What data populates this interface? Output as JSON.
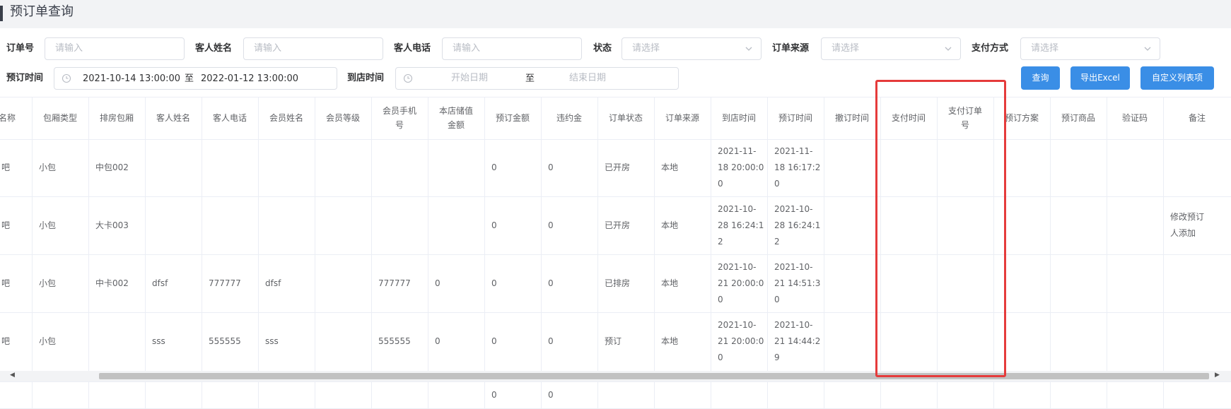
{
  "page_title": "预订单查询",
  "filters": {
    "order_no": {
      "label": "订单号",
      "placeholder": "请输入"
    },
    "guest_name": {
      "label": "客人姓名",
      "placeholder": "请输入"
    },
    "guest_phone": {
      "label": "客人电话",
      "placeholder": "请输入"
    },
    "status": {
      "label": "状态",
      "placeholder": "请选择"
    },
    "order_source": {
      "label": "订单来源",
      "placeholder": "请选择"
    },
    "payment_method": {
      "label": "支付方式",
      "placeholder": "请选择"
    },
    "booking_time": {
      "label": "预订时间",
      "start": "2021-10-14 13:00:00",
      "sep": "至",
      "end": "2022-01-12 13:00:00"
    },
    "arrival_time": {
      "label": "到店时间",
      "start_placeholder": "开始日期",
      "sep": "至",
      "end_placeholder": "结束日期"
    }
  },
  "buttons": {
    "query": "查询",
    "export": "导出Excel",
    "custom_columns": "自定义列表项"
  },
  "table": {
    "headers": [
      "名称",
      "包厢类型",
      "排房包厢",
      "客人姓名",
      "客人电话",
      "会员姓名",
      "会员等级",
      "会员手机号",
      "本店储值金额",
      "预订金额",
      "违约金",
      "订单状态",
      "订单来源",
      "到店时间",
      "预订时间",
      "撤订时间",
      "支付时间",
      "支付订单号",
      "预订方案",
      "预订商品",
      "验证码",
      "备注"
    ],
    "header_lines": {
      "7": [
        "会员手机",
        "号"
      ],
      "8": [
        "本店储值",
        "金额"
      ],
      "17": [
        "支付订单",
        "号"
      ]
    },
    "rows": [
      {
        "name": "酒吧",
        "room_type": "小包",
        "room": "中包002",
        "guest_name": "",
        "guest_phone": "",
        "member_name": "",
        "member_level": "",
        "member_phone": "",
        "stored_value": "",
        "booking_amount": "0",
        "penalty": "0",
        "status": "已开房",
        "source": "本地",
        "arrival": [
          "2021-11-",
          "18 20:00:0",
          "0"
        ],
        "booked": [
          "2021-11-",
          "18 16:17:2",
          "0"
        ],
        "cancelled": "",
        "paid_time": "",
        "pay_order_no": "",
        "plan": "",
        "goods": "",
        "code": "",
        "remark": []
      },
      {
        "name": "酒吧",
        "room_type": "小包",
        "room": "大卡003",
        "guest_name": "",
        "guest_phone": "",
        "member_name": "",
        "member_level": "",
        "member_phone": "",
        "stored_value": "",
        "booking_amount": "0",
        "penalty": "0",
        "status": "已开房",
        "source": "本地",
        "arrival": [
          "2021-10-",
          "28 16:24:1",
          "2"
        ],
        "booked": [
          "2021-10-",
          "28 16:24:1",
          "2"
        ],
        "cancelled": "",
        "paid_time": "",
        "pay_order_no": "",
        "plan": "",
        "goods": "",
        "code": "",
        "remark": [
          "修改预订",
          "人添加"
        ]
      },
      {
        "name": "酒吧",
        "room_type": "小包",
        "room": "中卡002",
        "guest_name": "dfsf",
        "guest_phone": "777777",
        "member_name": "dfsf",
        "member_level": "",
        "member_phone": "777777",
        "stored_value": "0",
        "booking_amount": "0",
        "penalty": "0",
        "status": "已排房",
        "source": "本地",
        "arrival": [
          "2021-10-",
          "21 20:00:0",
          "0"
        ],
        "booked": [
          "2021-10-",
          "21 14:51:3",
          "0"
        ],
        "cancelled": "",
        "paid_time": "",
        "pay_order_no": "",
        "plan": "",
        "goods": "",
        "code": "",
        "remark": []
      },
      {
        "name": "酒吧",
        "room_type": "小包",
        "room": "",
        "guest_name": "sss",
        "guest_phone": "555555",
        "member_name": "sss",
        "member_level": "",
        "member_phone": "555555",
        "stored_value": "0",
        "booking_amount": "0",
        "penalty": "0",
        "status": "预订",
        "source": "本地",
        "arrival": [
          "2021-10-",
          "21 20:00:0",
          "0"
        ],
        "booked": [
          "2021-10-",
          "21 14:44:2",
          "9"
        ],
        "cancelled": "",
        "paid_time": "",
        "pay_order_no": "",
        "plan": "",
        "goods": "",
        "code": "",
        "remark": []
      }
    ],
    "summary": {
      "booking_amount": "0",
      "penalty": "0"
    }
  },
  "colors": {
    "primary": "#3a8ee6",
    "highlight": "#e53b3b",
    "title_bg": "#f2f3f5"
  }
}
